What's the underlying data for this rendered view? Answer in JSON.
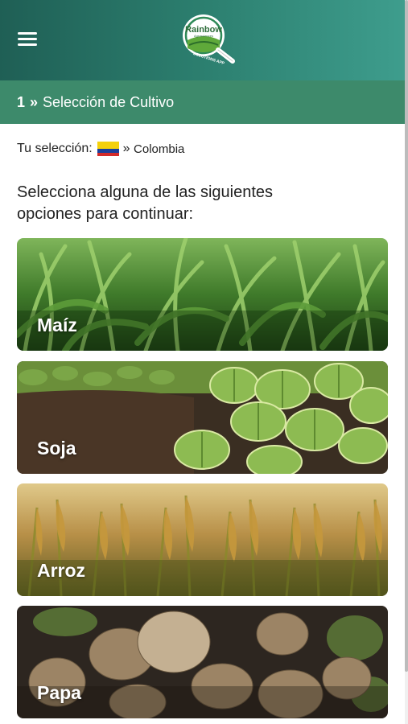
{
  "header": {
    "logo_text": "Rainbow",
    "logo_subtext": "SOLUTIONS APP"
  },
  "step": {
    "number": "1",
    "separator": "»",
    "title": "Selección de Cultivo"
  },
  "selection": {
    "label": "Tu selección:",
    "separator": "»",
    "country": "Colombia"
  },
  "instructions": "Selecciona alguna de las siguientes opciones para continuar:",
  "crops": [
    {
      "label": "Maíz"
    },
    {
      "label": "Soja"
    },
    {
      "label": "Arroz"
    },
    {
      "label": "Papa"
    }
  ],
  "colors": {
    "header_gradient_start": "#1f5f55",
    "header_gradient_end": "#3e9d8d",
    "step_bar": "#3d8a6b"
  }
}
